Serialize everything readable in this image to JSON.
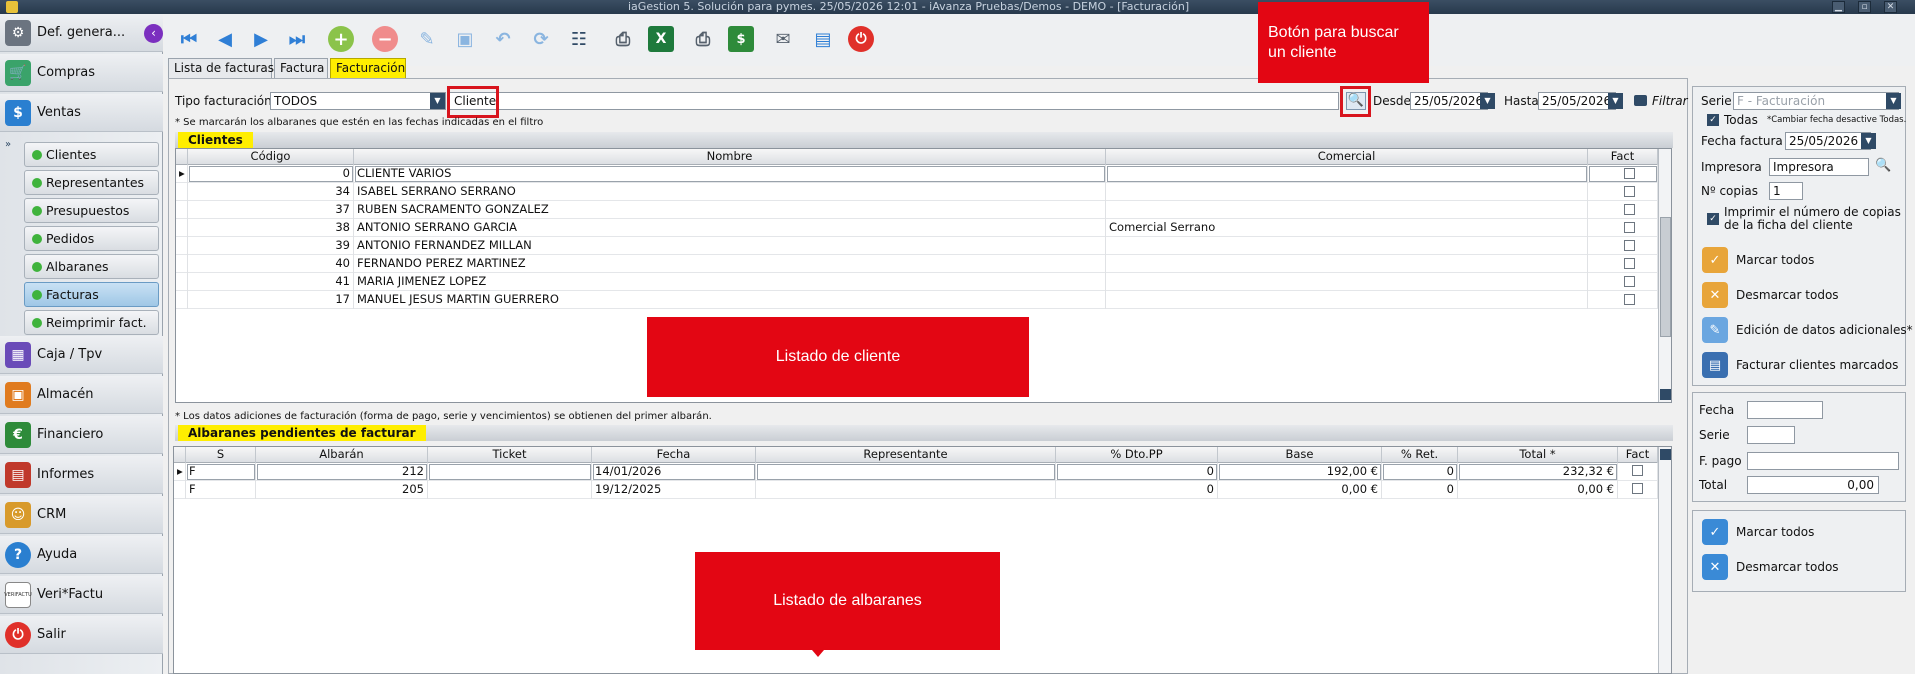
{
  "window": {
    "title": "iaGestion 5. Solución para pymes.  25/05/2026 12:01   -  iAvanza Pruebas/Demos - DEMO - [Facturación]"
  },
  "sidebar": {
    "top": {
      "label": "Def. genera..."
    },
    "sections": [
      {
        "label": "Compras",
        "icon": "cart-icon"
      },
      {
        "label": "Ventas",
        "icon": "sales-icon"
      }
    ],
    "subitems": [
      {
        "label": "Clientes"
      },
      {
        "label": "Representantes"
      },
      {
        "label": "Presupuestos"
      },
      {
        "label": "Pedidos"
      },
      {
        "label": "Albaranes"
      },
      {
        "label": "Facturas"
      },
      {
        "label": "Reimprimir fact."
      }
    ],
    "bottom": [
      {
        "label": "Caja / Tpv",
        "icon": "cash-register-icon"
      },
      {
        "label": "Almacén",
        "icon": "warehouse-icon"
      },
      {
        "label": "Financiero",
        "icon": "finance-icon"
      },
      {
        "label": "Informes",
        "icon": "reports-icon"
      },
      {
        "label": "CRM",
        "icon": "crm-icon"
      },
      {
        "label": "Ayuda",
        "icon": "help-icon"
      },
      {
        "label": "Veri*Factu",
        "icon": "verifactu-icon",
        "badge": "VERIFACTU"
      },
      {
        "label": "Salir",
        "icon": "power-icon"
      }
    ]
  },
  "tabs": [
    {
      "label": "Lista de facturas"
    },
    {
      "label": "Factura"
    },
    {
      "label": "Facturación"
    }
  ],
  "filters": {
    "tipo_label": "Tipo facturación",
    "tipo_value": "TODOS",
    "cliente_label": "Cliente",
    "desde_label": "Desde",
    "desde_value": "25/05/2026",
    "hasta_label": "Hasta",
    "hasta_value": "25/05/2026",
    "filtrar_label": "Filtrar",
    "note": "* Se marcarán los albaranes que estén en las fechas indicadas en el filtro"
  },
  "clientes": {
    "title": "Clientes",
    "columns": [
      "Código",
      "Nombre",
      "Comercial",
      "Fact"
    ],
    "rows": [
      {
        "codigo": "0",
        "nombre": "CLIENTE VARIOS",
        "comercial": ""
      },
      {
        "codigo": "34",
        "nombre": "ISABEL SERRANO SERRANO",
        "comercial": ""
      },
      {
        "codigo": "37",
        "nombre": "RUBEN SACRAMENTO GONZALEZ",
        "comercial": ""
      },
      {
        "codigo": "38",
        "nombre": "ANTONIO SERRANO GARCIA",
        "comercial": "Comercial Serrano"
      },
      {
        "codigo": "39",
        "nombre": "ANTONIO FERNANDEZ MILLAN",
        "comercial": ""
      },
      {
        "codigo": "40",
        "nombre": "FERNANDO PEREZ MARTINEZ",
        "comercial": ""
      },
      {
        "codigo": "41",
        "nombre": "MARIA JIMENEZ LOPEZ",
        "comercial": ""
      },
      {
        "codigo": "17",
        "nombre": "MANUEL JESUS MARTIN GUERRERO",
        "comercial": ""
      }
    ]
  },
  "albaranes": {
    "note": "* Los datos adiciones de facturación (forma de pago, serie y vencimientos) se obtienen del primer albarán.",
    "title": "Albaranes pendientes de facturar",
    "columns": [
      "S",
      "Albarán",
      "Ticket",
      "Fecha",
      "Representante",
      "% Dto.PP",
      "Base",
      "% Ret.",
      "Total *",
      "Fact"
    ],
    "rows": [
      {
        "s": "F",
        "albaran": "212",
        "ticket": "",
        "fecha": "14/01/2026",
        "repr": "",
        "dto": "0",
        "base": "192,00 €",
        "ret": "0",
        "total": "232,32 €"
      },
      {
        "s": "F",
        "albaran": "205",
        "ticket": "",
        "fecha": "19/12/2025",
        "repr": "",
        "dto": "0",
        "base": "0,00 €",
        "ret": "0",
        "total": "0,00 €"
      }
    ]
  },
  "right_panel": {
    "serie_label": "Serie",
    "serie_placeholder": "F - Facturación",
    "todas_label": "Todas",
    "todas_note": "*Cambiar fecha desactive Todas.",
    "fecha_factura_label": "Fecha factura",
    "fecha_factura_value": "25/05/2026",
    "impresora_label": "Impresora",
    "impresora_value": "Impresora",
    "copias_label": "Nº copias",
    "copias_value": "1",
    "imprimir_label": "Imprimir el número de copias de la ficha del cliente",
    "marcar_todos": "Marcar todos",
    "desmarcar_todos": "Desmarcar todos",
    "edicion_label": "Edición de datos adicionales*",
    "facturar_label": "Facturar clientes marcados",
    "fecha_label": "Fecha",
    "serie2_label": "Serie",
    "fpago_label": "F. pago",
    "total_label": "Total",
    "total_value": "0,00",
    "marcar_todos2": "Marcar todos",
    "desmarcar_todos2": "Desmarcar todos"
  },
  "callouts": {
    "buscar": "Botón para buscar un cliente",
    "listado_cliente": "Listado de cliente",
    "listado_albaranes": "Listado de albaranes"
  },
  "colors": {
    "highlight": "#ffee00",
    "callout": "#e30613",
    "accent": "#2f4a66"
  }
}
